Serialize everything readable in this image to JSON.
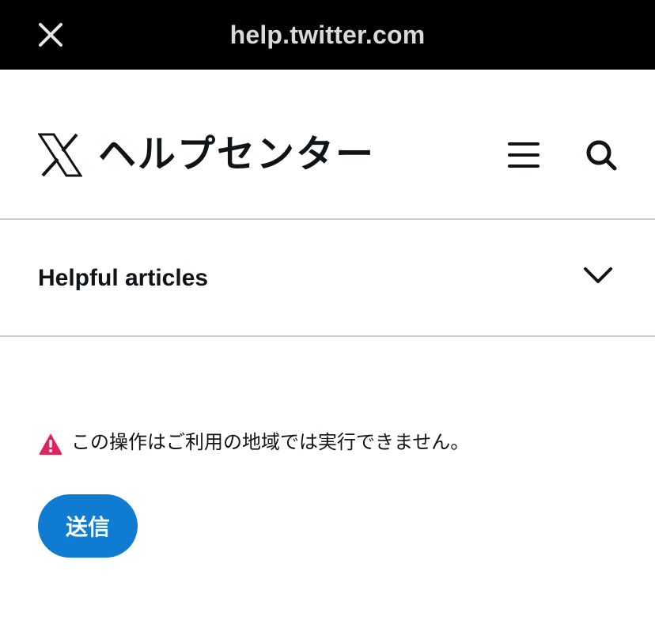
{
  "browser": {
    "url": "help.twitter.com",
    "close_icon": "close-icon"
  },
  "header": {
    "logo_icon": "x-logo-icon",
    "title": "ヘルプセンター",
    "menu_icon": "hamburger-menu-icon",
    "search_icon": "search-icon"
  },
  "accordion": {
    "label": "Helpful articles",
    "chevron_icon": "chevron-down-icon",
    "expanded": false
  },
  "error": {
    "icon": "warning-triangle-icon",
    "message": "この操作はご利用の地域では実行できません。",
    "icon_color": "#e0245e"
  },
  "submit": {
    "label": "送信",
    "color": "#0f7bd1"
  }
}
